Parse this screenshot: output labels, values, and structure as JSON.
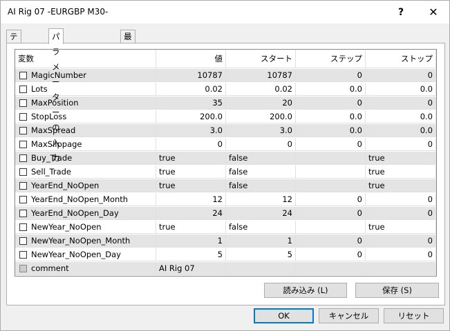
{
  "window": {
    "title": "AI Rig 07 -EURGBP M30-",
    "help": "?",
    "close": "✕"
  },
  "tabs": [
    "テスト設定",
    "パラメーターの入力",
    "最適化"
  ],
  "grid": {
    "headers": [
      "変数",
      "値",
      "スタート",
      "ステップ",
      "ストップ"
    ],
    "rows": [
      {
        "name": "MagicNumber",
        "value": "10787",
        "start": "10787",
        "step": "0",
        "stop": "0",
        "align": "num"
      },
      {
        "name": "Lots",
        "value": "0.02",
        "start": "0.02",
        "step": "0.0",
        "stop": "0.0",
        "align": "num"
      },
      {
        "name": "MaxPosition",
        "value": "35",
        "start": "20",
        "step": "0",
        "stop": "0",
        "align": "num"
      },
      {
        "name": "StopLoss",
        "value": "200.0",
        "start": "200.0",
        "step": "0.0",
        "stop": "0.0",
        "align": "num"
      },
      {
        "name": "MaxSpread",
        "value": "3.0",
        "start": "3.0",
        "step": "0.0",
        "stop": "0.0",
        "align": "num"
      },
      {
        "name": "MaxSlippage",
        "value": "0",
        "start": "0",
        "step": "0",
        "stop": "0",
        "align": "num"
      },
      {
        "name": "Buy_Trade",
        "value": "true",
        "start": "false",
        "step": "",
        "stop": "true",
        "align": "txt"
      },
      {
        "name": "Sell_Trade",
        "value": "true",
        "start": "false",
        "step": "",
        "stop": "true",
        "align": "txt"
      },
      {
        "name": "YearEnd_NoOpen",
        "value": "true",
        "start": "false",
        "step": "",
        "stop": "true",
        "align": "txt"
      },
      {
        "name": "YearEnd_NoOpen_Month",
        "value": "12",
        "start": "12",
        "step": "0",
        "stop": "0",
        "align": "num"
      },
      {
        "name": "YearEnd_NoOpen_Day",
        "value": "24",
        "start": "24",
        "step": "0",
        "stop": "0",
        "align": "num"
      },
      {
        "name": "NewYear_NoOpen",
        "value": "true",
        "start": "false",
        "step": "",
        "stop": "true",
        "align": "txt"
      },
      {
        "name": "NewYear_NoOpen_Month",
        "value": "1",
        "start": "1",
        "step": "0",
        "stop": "0",
        "align": "num"
      },
      {
        "name": "NewYear_NoOpen_Day",
        "value": "5",
        "start": "5",
        "step": "0",
        "stop": "0",
        "align": "num"
      },
      {
        "name": "comment",
        "value": "AI Rig 07",
        "start": "",
        "step": "",
        "stop": "",
        "align": "txt"
      }
    ]
  },
  "buttons": {
    "load": "読み込み (L)",
    "save": "保存 (S)",
    "ok": "OK",
    "cancel": "キャンセル",
    "reset": "リセット"
  }
}
